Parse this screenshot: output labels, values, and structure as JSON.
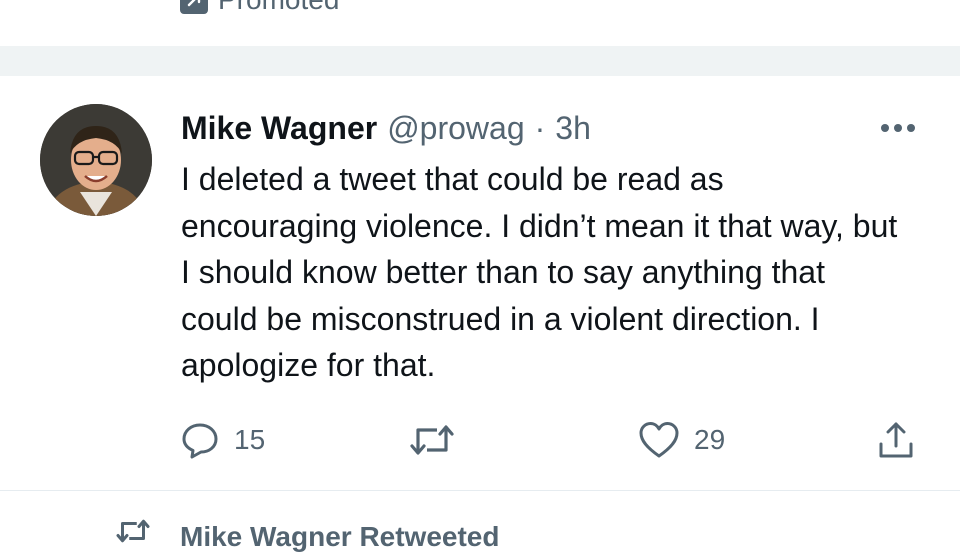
{
  "promoted": {
    "label": "Promoted",
    "icon": "promoted-arrow-icon"
  },
  "tweet": {
    "author_name": "Mike Wagner",
    "handle": "@prowag",
    "separator": "·",
    "time": "3h",
    "text": "I deleted a tweet that could be read as encouraging violence. I didn’t mean it that way, but I should know better than to say anything that could be misconstrued in a violent direction. I apologize for that.",
    "actions": {
      "reply_count": "15",
      "retweet_count": "",
      "like_count": "29"
    }
  },
  "next_tweet": {
    "retweeted_label": "Mike Wagner Retweeted"
  },
  "colors": {
    "text_primary": "#0f1419",
    "text_secondary": "#536471",
    "separator_bg": "#eff3f4"
  }
}
